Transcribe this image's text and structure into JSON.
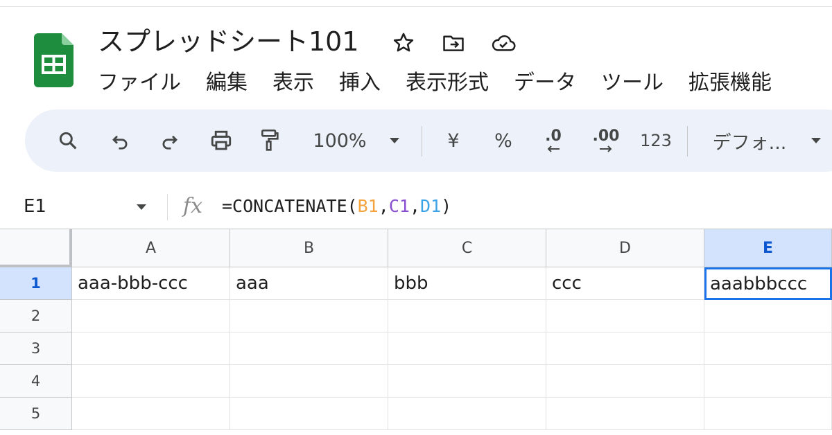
{
  "app": {
    "doc_title": "スプレッドシート101",
    "brand_color": "#1e8e3e"
  },
  "menu": [
    "ファイル",
    "編集",
    "表示",
    "挿入",
    "表示形式",
    "データ",
    "ツール",
    "拡張機能"
  ],
  "toolbar": {
    "zoom": "100%",
    "currency": "¥",
    "percent": "%",
    "decrease_decimal": ".0",
    "increase_decimal": ".00",
    "number_format": "123",
    "font": "デフォ..."
  },
  "formula_bar": {
    "cell_ref": "E1",
    "fx_label": "fx",
    "formula_prefix": "=CONCATENATE(",
    "ref1": "B1",
    "sep1": ",",
    "ref2": "C1",
    "sep2": ",",
    "ref3": "D1",
    "formula_suffix": ")"
  },
  "sheet": {
    "columns": [
      "A",
      "B",
      "C",
      "D",
      "E"
    ],
    "rows": [
      "1",
      "2",
      "3",
      "4",
      "5"
    ],
    "selected_column": "E",
    "selected_row": "1",
    "cells": {
      "A1": "aaa-bbb-ccc",
      "B1": "aaa",
      "C1": "bbb",
      "D1": "ccc",
      "E1": "aaabbbccc"
    }
  }
}
